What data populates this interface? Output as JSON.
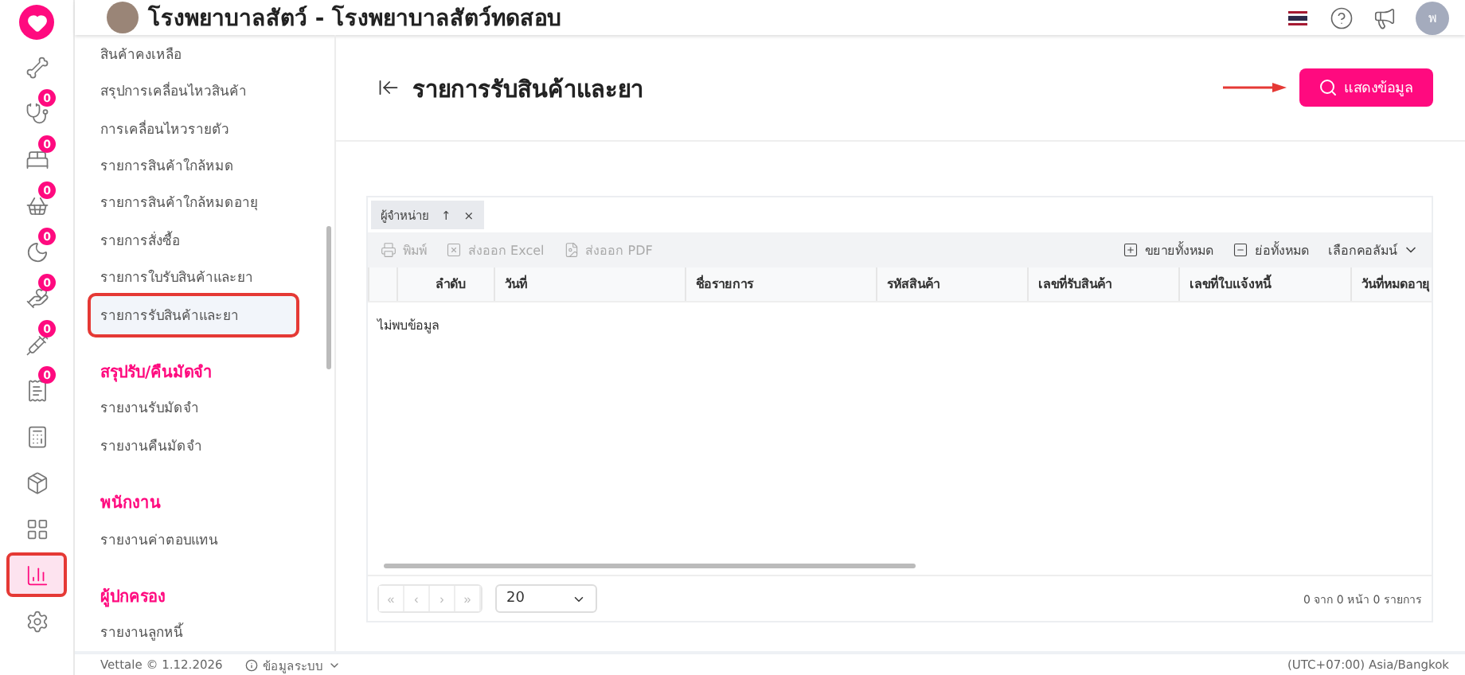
{
  "header": {
    "title": "โรงพยาบาลสัตว์ - โรงพยาบาลสัตว์ทดสอบ",
    "avatar_initial": "พ"
  },
  "rail": [
    {
      "selected": false
    },
    {
      "badge": "0",
      "selected": false
    },
    {
      "badge": "0",
      "selected": false
    },
    {
      "badge": "0",
      "selected": false
    },
    {
      "badge": "0",
      "selected": false
    },
    {
      "badge": "0",
      "selected": false
    },
    {
      "badge": "0",
      "selected": false
    },
    {
      "badge": "0",
      "selected": false
    },
    {
      "selected": false
    },
    {
      "selected": false
    },
    {
      "selected": false
    },
    {
      "selected": true
    },
    {
      "selected": false
    }
  ],
  "sidebar": [
    {
      "kind": "item",
      "label": "สินค้าคงเหลือ",
      "selected": false
    },
    {
      "kind": "item",
      "label": "สรุปการเคลื่อนไหวสินค้า",
      "selected": false
    },
    {
      "kind": "item",
      "label": "การเคลื่อนไหวรายตัว",
      "selected": false
    },
    {
      "kind": "item",
      "label": "รายการสินค้าใกล้หมด",
      "selected": false
    },
    {
      "kind": "item",
      "label": "รายการสินค้าใกล้หมดอายุ",
      "selected": false
    },
    {
      "kind": "item",
      "label": "รายการสั่งซื้อ",
      "selected": false
    },
    {
      "kind": "item",
      "label": "รายการใบรับสินค้าและยา",
      "selected": false
    },
    {
      "kind": "item",
      "label": "รายการรับสินค้าและยา",
      "selected": true
    },
    {
      "kind": "heading",
      "label": "สรุปรับ/คืนมัดจำ"
    },
    {
      "kind": "item",
      "label": "รายงานรับมัดจำ",
      "selected": false
    },
    {
      "kind": "item",
      "label": "รายงานคืนมัดจำ",
      "selected": false
    },
    {
      "kind": "heading",
      "label": "พนักงาน"
    },
    {
      "kind": "item",
      "label": "รายงานค่าตอบแทน",
      "selected": false
    },
    {
      "kind": "heading",
      "label": "ผู้ปกครอง"
    },
    {
      "kind": "item",
      "label": "รายงานลูกหนี้",
      "selected": false
    }
  ],
  "page": {
    "title": "รายการรับสินค้าและยา",
    "show_button": "แสดงข้อมูล"
  },
  "grid": {
    "group_chip": "ผู้จำหน่าย",
    "chip_sort": "↑",
    "chip_remove": "×",
    "toolbar_left": [
      {
        "label": "พิมพ์",
        "disabled": true
      },
      {
        "label": "ส่งออก Excel",
        "disabled": true
      },
      {
        "label": "ส่งออก PDF",
        "disabled": true
      }
    ],
    "toolbar_right": [
      {
        "label": "ขยายทั้งหมด"
      },
      {
        "label": "ย่อทั้งหมด"
      },
      {
        "label": "เลือกคอลัมน์"
      }
    ],
    "columns": [
      "ลำดับ",
      "วันที่",
      "ชื่อรายการ",
      "รหัสสินค้า",
      "เลขที่รับสินค้า",
      "เลขที่ใบแจ้งหนี้",
      "วันที่หมดอายุ"
    ],
    "empty": "ไม่พบข้อมูล",
    "pager": [
      "«",
      "‹",
      "›",
      "»"
    ],
    "page_size": "20",
    "summary": "0 จาก 0 หน้า 0 รายการ"
  },
  "footer": {
    "brand": "Vettale © 1.12.2026",
    "info": "ข้อมูลระบบ",
    "timezone": "(UTC+07:00) Asia/Bangkok"
  }
}
